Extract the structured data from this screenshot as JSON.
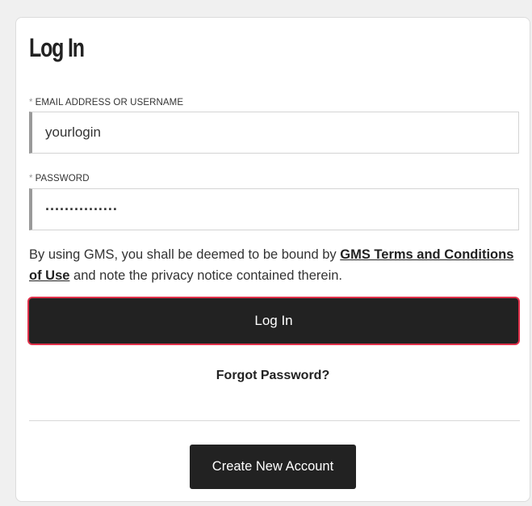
{
  "login_card": {
    "title": "Log In",
    "email": {
      "required_marker": "*",
      "label": "EMAIL ADDRESS OR USERNAME",
      "value": "yourlogin"
    },
    "password": {
      "required_marker": "*",
      "label": "PASSWORD",
      "value": "···············"
    },
    "terms": {
      "prefix": "By using GMS, you shall be deemed to be bound by ",
      "link_text": "GMS Terms and Conditions of Use",
      "suffix": " and note the privacy notice contained therein."
    },
    "login_button_label": "Log In",
    "forgot_password_label": "Forgot Password?",
    "create_account_label": "Create New Account"
  },
  "colors": {
    "button_background": "#222222",
    "login_button_border": "#e0304a",
    "input_left_accent": "#9a9a9a"
  }
}
